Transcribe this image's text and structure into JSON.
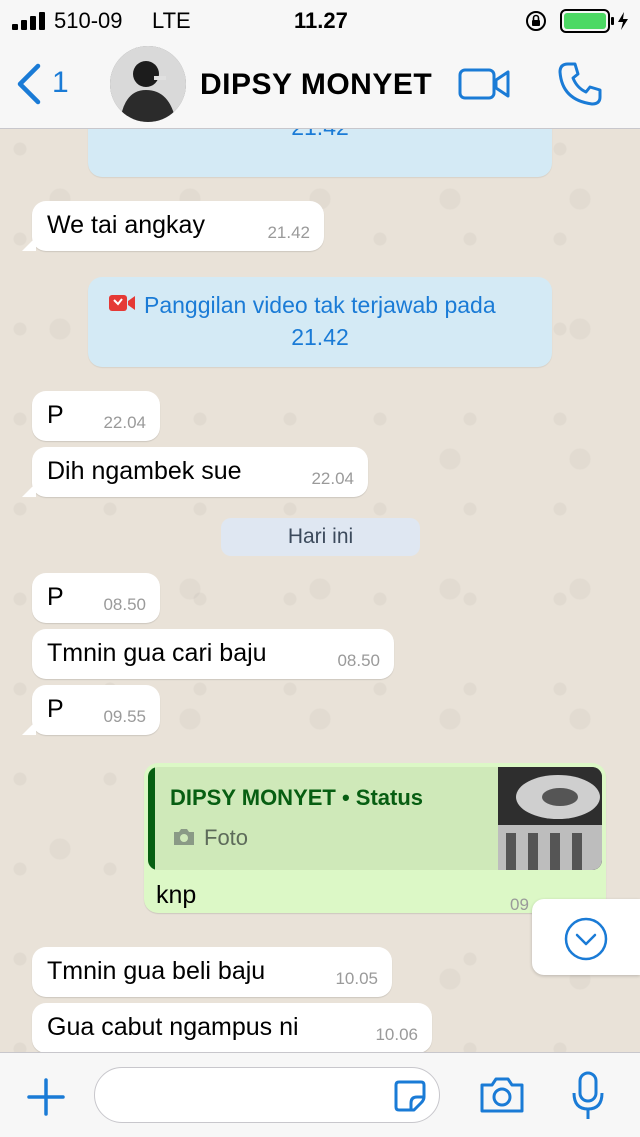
{
  "status_bar": {
    "carrier": "510-09",
    "network": "LTE",
    "time": "11.27"
  },
  "nav": {
    "back_count": "1",
    "contact_name": "DIPSY MONYET",
    "icons": [
      "back-chevron-icon",
      "avatar",
      "video-call-icon",
      "phone-icon"
    ]
  },
  "messages": {
    "sys_top_time": "21.42",
    "m1_text": "We tai angkay",
    "m1_time": "21.42",
    "missed_text": "Panggilan video tak terjawab pada",
    "missed_time": "21.42",
    "m2_text": "P",
    "m2_time": "22.04",
    "m3_text": "Dih ngambek sue",
    "m3_time": "22.04",
    "day_label": "Hari ini",
    "m4_text": "P",
    "m4_time": "08.50",
    "m5_text": "Tmnin gua cari baju",
    "m5_time": "08.50",
    "m6_text": "P",
    "m6_time": "09.55",
    "out_quote_title": "DIPSY MONYET • Status",
    "out_quote_sub": "Foto",
    "out_text": "knp",
    "out_time": "09",
    "m7_text": "Tmnin gua beli baju",
    "m7_time": "10.05",
    "m8_text": "Gua cabut ngampus ni",
    "m8_time": "10.06"
  },
  "colors": {
    "accent": "#1a7bd6",
    "outgoing_bubble": "#dcf8c6",
    "system_bubble": "#d4eaf5",
    "quote_green": "#075e12"
  }
}
